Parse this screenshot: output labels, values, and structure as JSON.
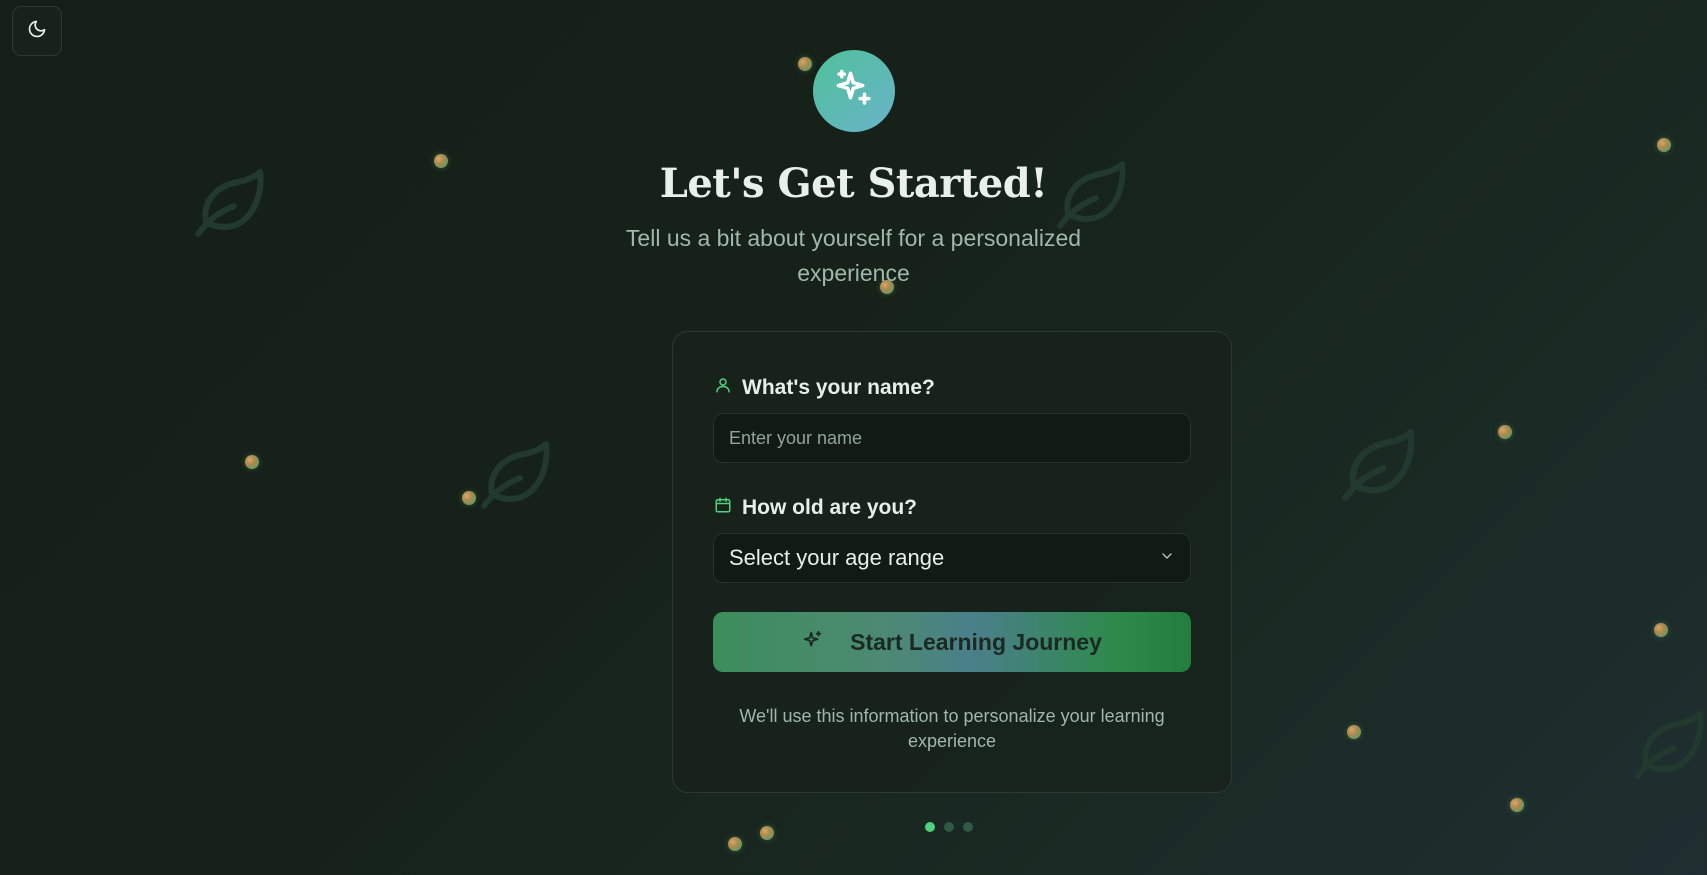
{
  "theme_toggle": {
    "icon": "moon-icon"
  },
  "hero": {
    "logo_icon": "sparkles-icon",
    "title": "Let's Get Started!",
    "subtitle": "Tell us a bit about yourself for a personalized experience"
  },
  "form": {
    "name": {
      "label": "What's your name?",
      "icon": "user-icon",
      "placeholder": "Enter your name",
      "value": ""
    },
    "age": {
      "label": "How old are you?",
      "icon": "calendar-icon",
      "selected": "Select your age range"
    },
    "submit": {
      "label": "Start Learning Journey",
      "icon": "sparkles-icon"
    },
    "footnote": "We'll use this information to personalize your learning experience"
  },
  "pager": {
    "total": 3,
    "active": 1
  },
  "colors": {
    "accent": "#4fd17e",
    "background": "#141f19",
    "card": "#17221c",
    "logo_gradient": [
      "#4fc19a",
      "#6ab3c9"
    ]
  }
}
